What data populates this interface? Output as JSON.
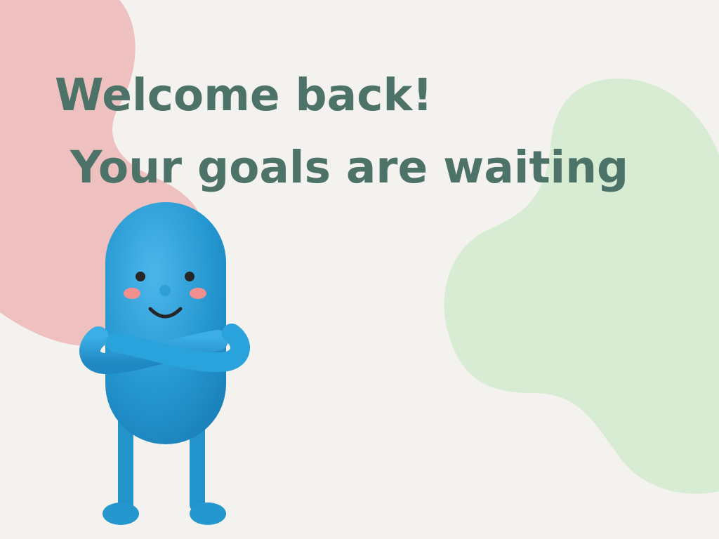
{
  "screen": {
    "headline_line1": "Welcome back!",
    "headline_line2": "Your goals are waiting"
  },
  "colors": {
    "background": "#f4f2ef",
    "headline": "#4d7369",
    "pink_blob": "#efc0c0",
    "green_blob": "#d8ebd3",
    "mascot": "#2a9bd4"
  },
  "illustration": {
    "mascot": "blue-pill-mascot-icon"
  }
}
